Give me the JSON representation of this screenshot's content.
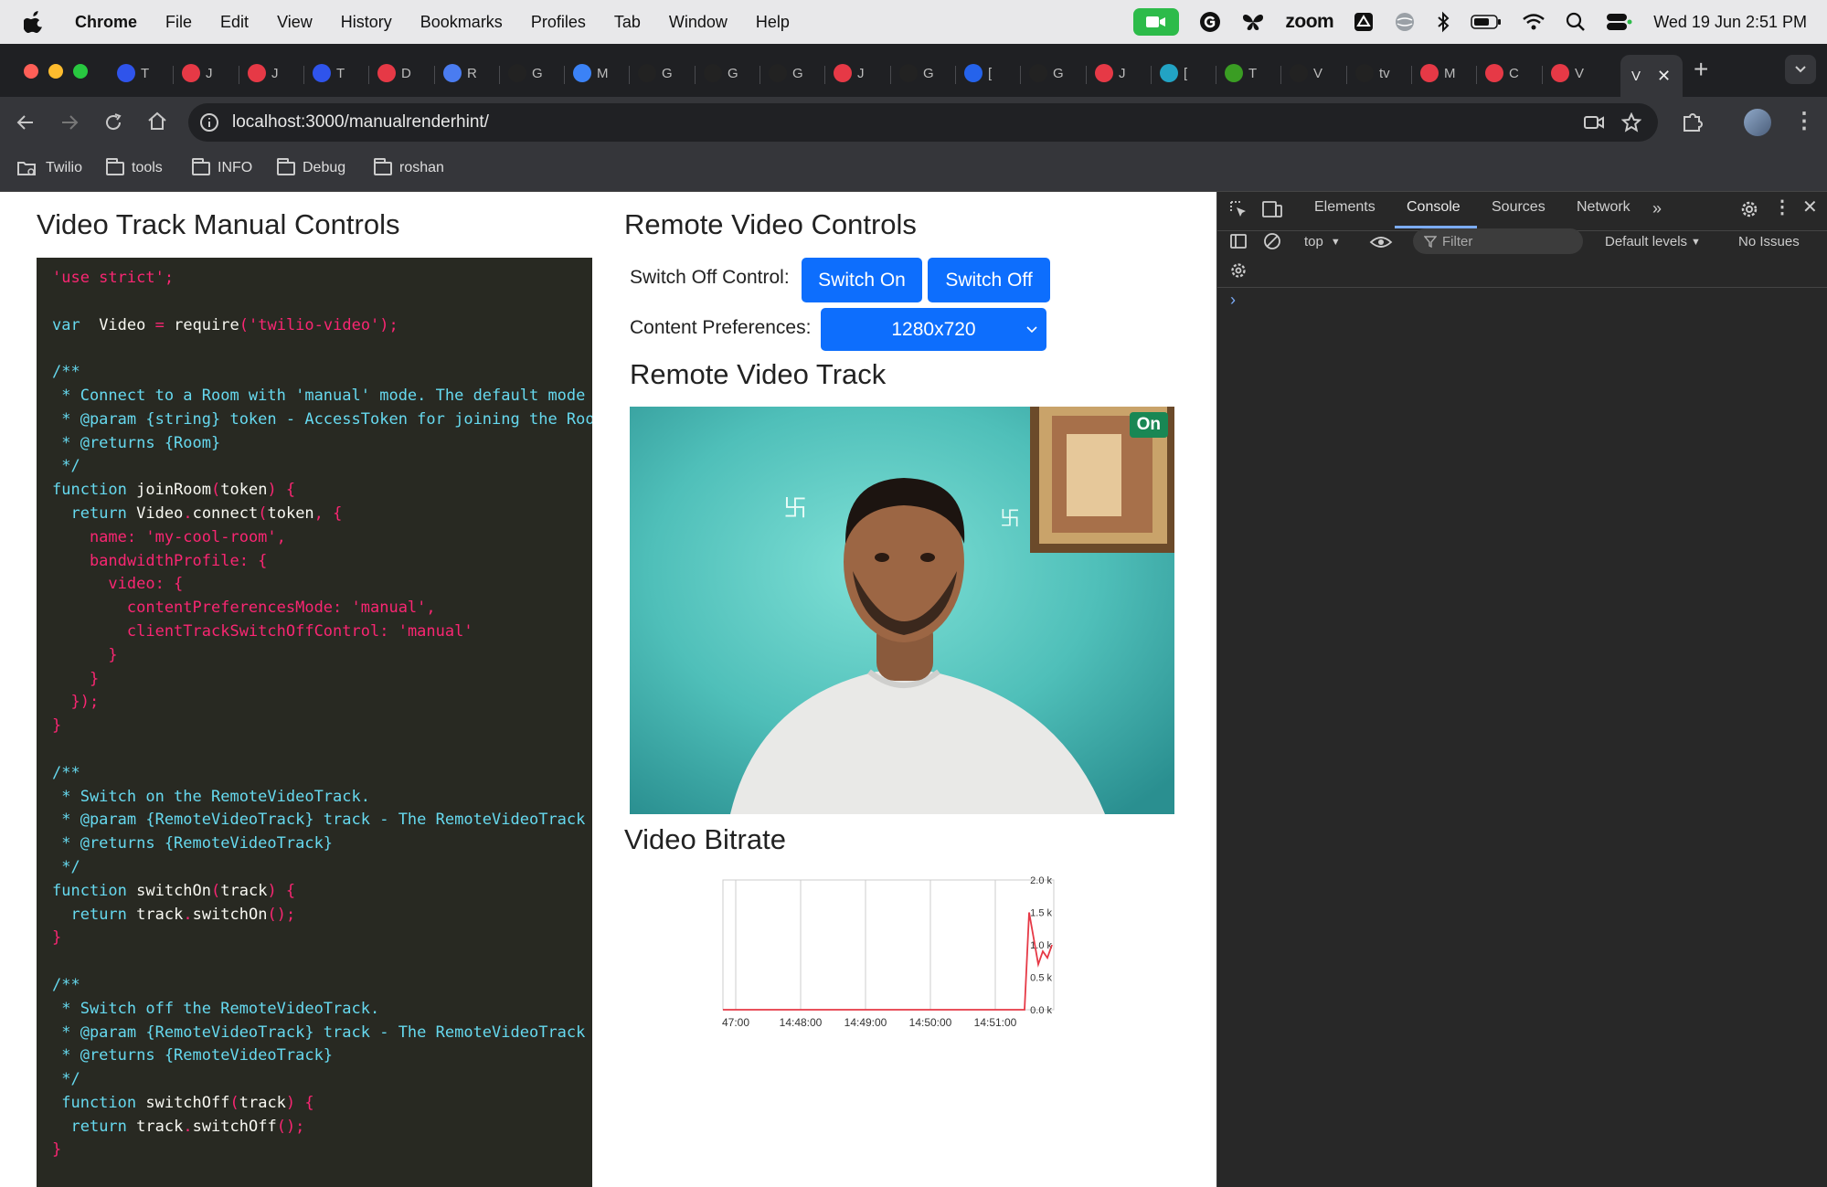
{
  "menubar": {
    "app": "Chrome",
    "items": [
      "File",
      "Edit",
      "View",
      "History",
      "Bookmarks",
      "Profiles",
      "Tab",
      "Window",
      "Help"
    ],
    "zoom_label": "zoom",
    "datetime": "Wed 19 Jun  2:51 PM"
  },
  "tabs": [
    {
      "icon": "twilio-icon",
      "label": "T",
      "color": "#2f54eb"
    },
    {
      "icon": "jira-record-icon",
      "label": "J",
      "color": "#e63946"
    },
    {
      "icon": "jira-record-icon",
      "label": "J",
      "color": "#e63946"
    },
    {
      "icon": "twilio-icon",
      "label": "T",
      "color": "#2f54eb"
    },
    {
      "icon": "record-icon",
      "label": "D",
      "color": "#e63946"
    },
    {
      "icon": "docs-icon",
      "label": "R",
      "color": "#4a7cf0"
    },
    {
      "icon": "github-icon",
      "label": "G",
      "color": "#222"
    },
    {
      "icon": "meet-icon",
      "label": "M",
      "color": "#3b82f6"
    },
    {
      "icon": "github-icon",
      "label": "G",
      "color": "#222"
    },
    {
      "icon": "github-icon",
      "label": "G",
      "color": "#222"
    },
    {
      "icon": "github-icon",
      "label": "G",
      "color": "#222"
    },
    {
      "icon": "record-icon",
      "label": "J",
      "color": "#e63946"
    },
    {
      "icon": "github-icon",
      "label": "G",
      "color": "#222"
    },
    {
      "icon": "confluence-icon",
      "label": "[",
      "color": "#2563eb"
    },
    {
      "icon": "github-icon",
      "label": "G",
      "color": "#222"
    },
    {
      "icon": "record-icon",
      "label": "J",
      "color": "#e63946"
    },
    {
      "icon": "app-icon",
      "label": "[",
      "color": "#22a3c4"
    },
    {
      "icon": "pen-icon",
      "label": "T",
      "color": "#3a9d23"
    },
    {
      "icon": "github-icon",
      "label": "V",
      "color": "#222"
    },
    {
      "icon": "github-icon",
      "label": "tv",
      "color": "#222"
    },
    {
      "icon": "record-icon",
      "label": "M",
      "color": "#e63946"
    },
    {
      "icon": "record-icon",
      "label": "C",
      "color": "#e63946"
    },
    {
      "icon": "record-icon",
      "label": "V",
      "color": "#e63946"
    }
  ],
  "active_tab": {
    "label": "V"
  },
  "url": "localhost:3000/manualrenderhint/",
  "bookmarks": [
    "Twilio",
    "tools",
    "INFO",
    "Debug",
    "roshan"
  ],
  "page": {
    "left_title": "Video Track Manual Controls",
    "right_title": "Remote Video Controls",
    "switch_label": "Switch Off Control:",
    "switch_on": "Switch On",
    "switch_off": "Switch Off",
    "content_label": "Content Preferences:",
    "resolution": "1280x720",
    "track_title": "Remote Video Track",
    "track_badge": "On",
    "bitrate_title": "Video Bitrate"
  },
  "code_lines": [
    [
      [
        "c-str2",
        "'use strict'"
      ],
      [
        "c-punc",
        ";"
      ]
    ],
    [],
    [
      [
        "c-kw",
        "var"
      ],
      [
        "",
        "  Video "
      ],
      [
        "c-punc",
        "="
      ],
      [
        "",
        " require"
      ],
      [
        "c-punc",
        "("
      ],
      [
        "c-str2",
        "'twilio-video'"
      ],
      [
        "c-punc",
        ");"
      ]
    ],
    [],
    [
      [
        "c-com",
        "/**"
      ]
    ],
    [
      [
        "c-com",
        " * Connect to a Room with 'manual' mode. The default mode"
      ]
    ],
    [
      [
        "c-com",
        " * @param {string} token - AccessToken for joining the Roo"
      ]
    ],
    [
      [
        "c-com",
        " * @returns {Room}"
      ]
    ],
    [
      [
        "c-com",
        " */"
      ]
    ],
    [
      [
        "c-kw",
        "function"
      ],
      [
        "",
        " joinRoom"
      ],
      [
        "c-punc",
        "("
      ],
      [
        "",
        "token"
      ],
      [
        "c-punc",
        ") {"
      ]
    ],
    [
      [
        "",
        "  "
      ],
      [
        "c-kw",
        "return"
      ],
      [
        "",
        " Video"
      ],
      [
        "c-punc",
        "."
      ],
      [
        "",
        "connect"
      ],
      [
        "c-punc",
        "("
      ],
      [
        "",
        "token"
      ],
      [
        "c-punc",
        ", {"
      ]
    ],
    [
      [
        "c-prop",
        "    name: "
      ],
      [
        "c-str2",
        "'my-cool-room'"
      ],
      [
        "c-punc",
        ","
      ]
    ],
    [
      [
        "c-prop",
        "    bandwidthProfile: {"
      ]
    ],
    [
      [
        "c-prop",
        "      video: {"
      ]
    ],
    [
      [
        "c-prop",
        "        contentPreferencesMode: "
      ],
      [
        "c-str2",
        "'manual'"
      ],
      [
        "c-punc",
        ","
      ]
    ],
    [
      [
        "c-prop",
        "        clientTrackSwitchOffControl: "
      ],
      [
        "c-str2",
        "'manual'"
      ]
    ],
    [
      [
        "c-punc",
        "      }"
      ]
    ],
    [
      [
        "c-punc",
        "    }"
      ]
    ],
    [
      [
        "c-punc",
        "  });"
      ]
    ],
    [
      [
        "c-punc",
        "}"
      ]
    ],
    [],
    [
      [
        "c-com",
        "/**"
      ]
    ],
    [
      [
        "c-com",
        " * Switch on the RemoteVideoTrack."
      ]
    ],
    [
      [
        "c-com",
        " * @param {RemoteVideoTrack} track - The RemoteVideoTrack"
      ]
    ],
    [
      [
        "c-com",
        " * @returns {RemoteVideoTrack}"
      ]
    ],
    [
      [
        "c-com",
        " */"
      ]
    ],
    [
      [
        "c-kw",
        "function"
      ],
      [
        "",
        " switchOn"
      ],
      [
        "c-punc",
        "("
      ],
      [
        "",
        "track"
      ],
      [
        "c-punc",
        ") {"
      ]
    ],
    [
      [
        "",
        "  "
      ],
      [
        "c-kw",
        "return"
      ],
      [
        "",
        " track"
      ],
      [
        "c-punc",
        "."
      ],
      [
        "",
        "switchOn"
      ],
      [
        "c-punc",
        "();"
      ]
    ],
    [
      [
        "c-punc",
        "}"
      ]
    ],
    [],
    [
      [
        "c-com",
        "/**"
      ]
    ],
    [
      [
        "c-com",
        " * Switch off the RemoteVideoTrack."
      ]
    ],
    [
      [
        "c-com",
        " * @param {RemoteVideoTrack} track - The RemoteVideoTrack"
      ]
    ],
    [
      [
        "c-com",
        " * @returns {RemoteVideoTrack}"
      ]
    ],
    [
      [
        "c-com",
        " */"
      ]
    ],
    [
      [
        "c-kw",
        " function"
      ],
      [
        "",
        " switchOff"
      ],
      [
        "c-punc",
        "("
      ],
      [
        "",
        "track"
      ],
      [
        "c-punc",
        ") {"
      ]
    ],
    [
      [
        "",
        "  "
      ],
      [
        "c-kw",
        "return"
      ],
      [
        "",
        " track"
      ],
      [
        "c-punc",
        "."
      ],
      [
        "",
        "switchOff"
      ],
      [
        "c-punc",
        "();"
      ]
    ],
    [
      [
        "c-punc",
        "}"
      ]
    ]
  ],
  "chart_data": {
    "type": "line",
    "x": [
      "47:00",
      "14:48:00",
      "14:49:00",
      "14:50:00",
      "14:51:00"
    ],
    "yticks": [
      "2.0 k",
      "1.5 k",
      "1.0 k",
      "0.5 k",
      "0.0 k"
    ],
    "ylim": [
      0,
      2000
    ],
    "series": [
      {
        "values": [
          0,
          0,
          0,
          0,
          0,
          0,
          0,
          1500,
          1100,
          700,
          900,
          800,
          1000
        ]
      }
    ],
    "line_color": "#e63946"
  },
  "devtools": {
    "tabs": [
      "Elements",
      "Console",
      "Sources",
      "Network"
    ],
    "active": "Console",
    "context": "top",
    "filter_placeholder": "Filter",
    "levels": "Default levels",
    "issues": "No Issues"
  }
}
